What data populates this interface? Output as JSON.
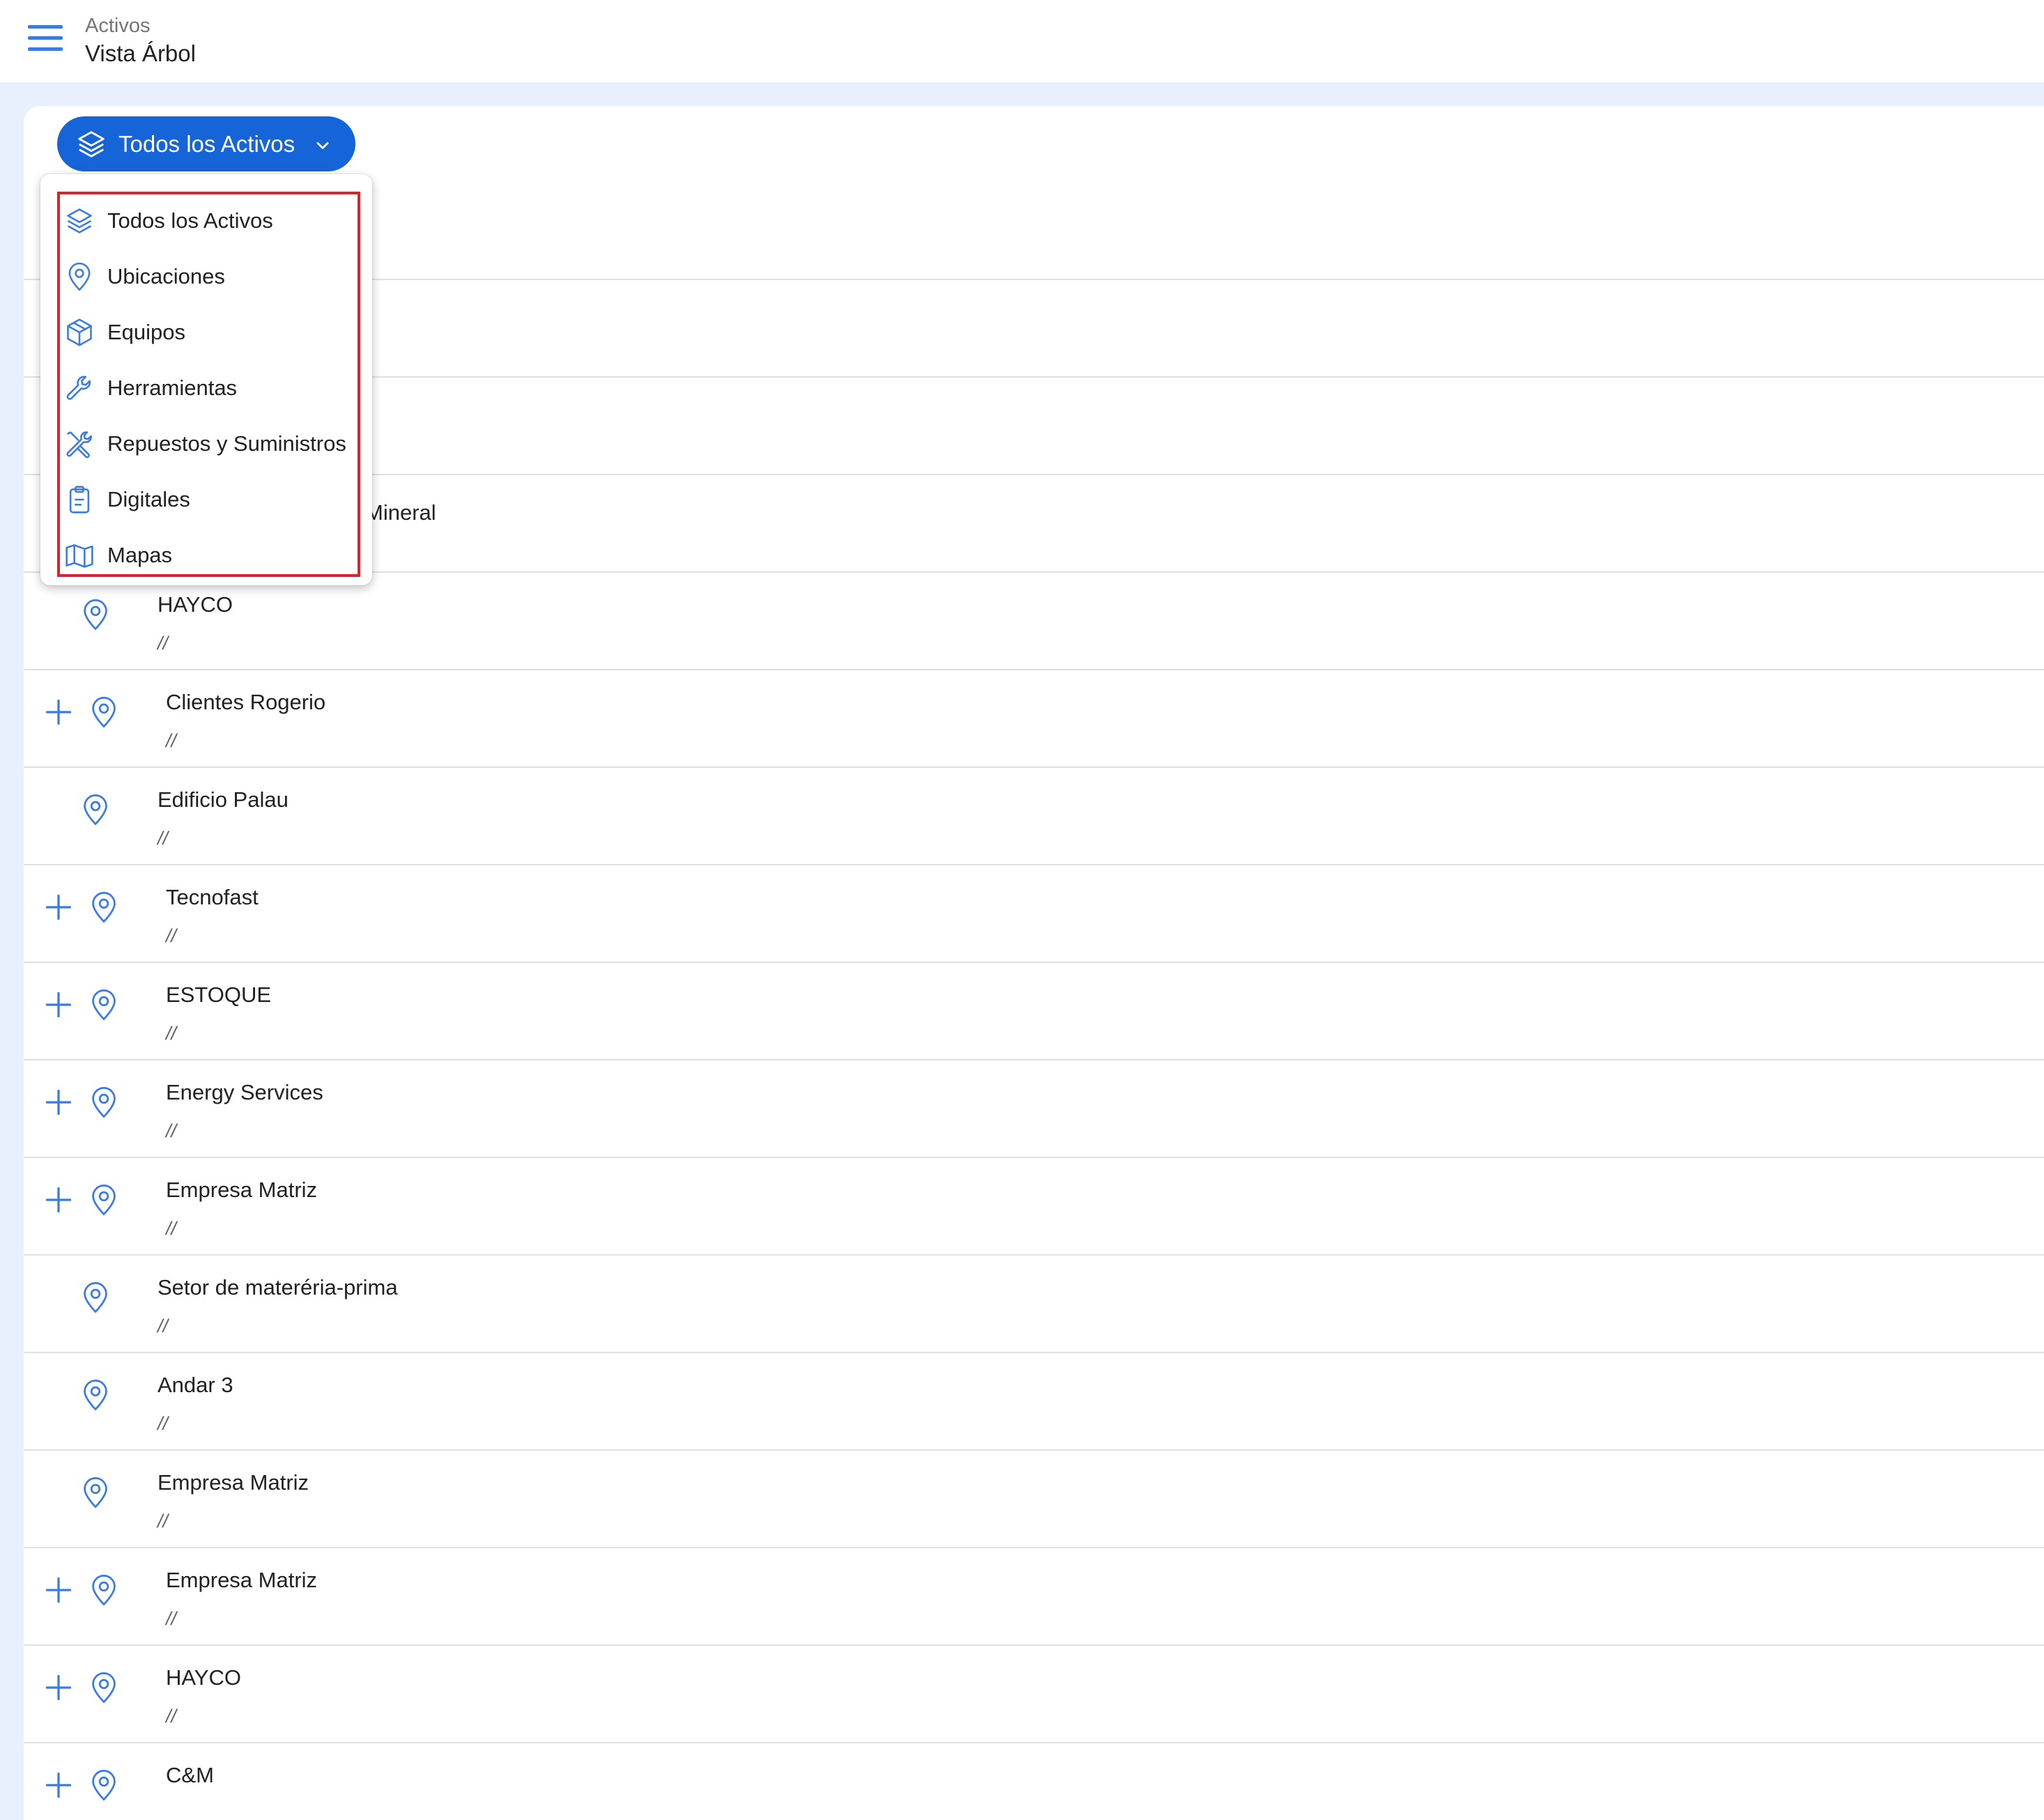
{
  "header": {
    "subtitle": "Activos",
    "title": "Vista Árbol"
  },
  "filter": {
    "selected_label": "Todos los Activos",
    "options": [
      {
        "label": "Todos los Activos",
        "icon": "layers-icon"
      },
      {
        "label": "Ubicaciones",
        "icon": "location-pin-icon"
      },
      {
        "label": "Equipos",
        "icon": "box-icon"
      },
      {
        "label": "Herramientas",
        "icon": "wrench-icon"
      },
      {
        "label": "Repuestos y Suministros",
        "icon": "tools-icon"
      },
      {
        "label": "Digitales",
        "icon": "clipboard-icon"
      },
      {
        "label": "Mapas",
        "icon": "map-icon"
      }
    ]
  },
  "tree": {
    "partially_visible_row_text": "Mineral",
    "rows": [
      {
        "name": "HAYCO",
        "path": "//",
        "expandable": false
      },
      {
        "name": "Clientes Rogerio",
        "path": "//",
        "expandable": true
      },
      {
        "name": "Edificio Palau",
        "path": "//",
        "expandable": false
      },
      {
        "name": "Tecnofast",
        "path": "//",
        "expandable": true
      },
      {
        "name": "ESTOQUE",
        "path": "//",
        "expandable": true
      },
      {
        "name": "Energy Services",
        "path": "//",
        "expandable": true
      },
      {
        "name": "Empresa Matriz",
        "path": "//",
        "expandable": true
      },
      {
        "name": "Setor de materéria-prima",
        "path": "//",
        "expandable": false
      },
      {
        "name": "Andar 3",
        "path": "//",
        "expandable": false
      },
      {
        "name": "Empresa Matriz",
        "path": "//",
        "expandable": false
      },
      {
        "name": "Empresa Matriz",
        "path": "//",
        "expandable": true
      },
      {
        "name": "HAYCO",
        "path": "//",
        "expandable": true
      },
      {
        "name": "C&M",
        "path": "",
        "expandable": true
      }
    ]
  },
  "colors": {
    "primary": "#1565d8",
    "icon_blue": "#3a7be0",
    "background": "#e8f0fe",
    "highlight_border": "#e0202a"
  }
}
